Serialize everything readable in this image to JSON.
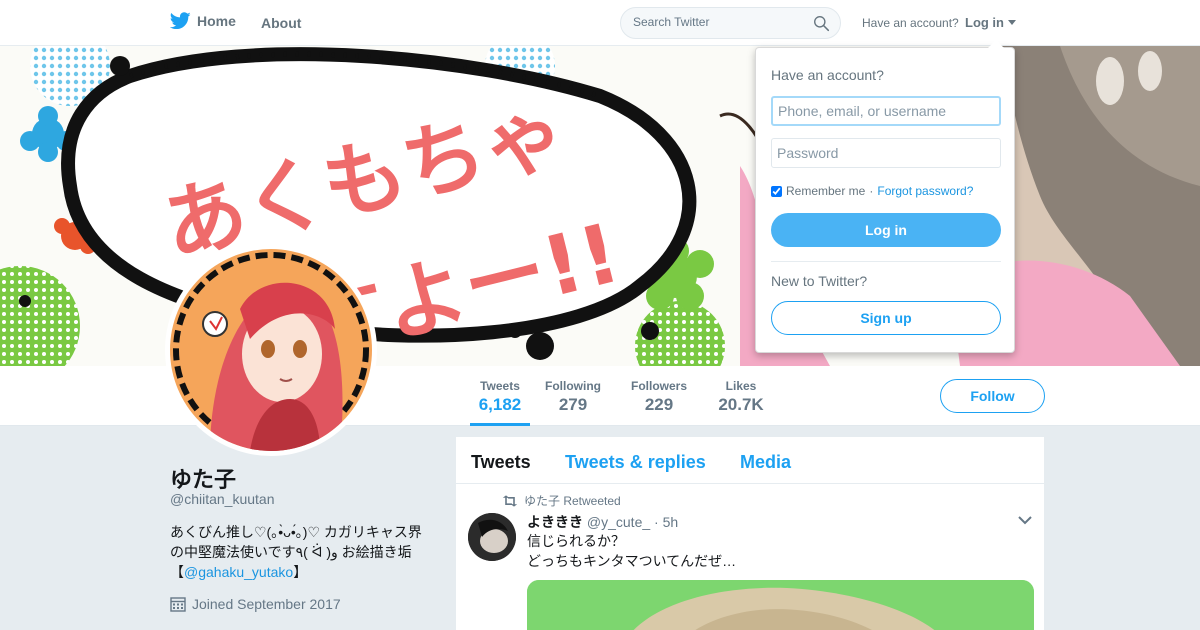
{
  "nav": {
    "home_label": "Home",
    "about_label": "About",
    "search_placeholder": "Search Twitter",
    "have_account": "Have an account?",
    "login_label": "Log in"
  },
  "login_dropdown": {
    "title": "Have an account?",
    "username_placeholder": "Phone, email, or username",
    "password_placeholder": "Password",
    "remember_label": "Remember me",
    "separator": "·",
    "forgot_label": "Forgot password?",
    "login_button": "Log in",
    "new_label": "New to Twitter?",
    "signup_button": "Sign up"
  },
  "banner": {
    "artwork_text_line1": "あくもちゃ",
    "artwork_text_line2": "すよー!!"
  },
  "stats": [
    {
      "label": "Tweets",
      "value": "6,182"
    },
    {
      "label": "Following",
      "value": "279"
    },
    {
      "label": "Followers",
      "value": "229"
    },
    {
      "label": "Likes",
      "value": "20.7K"
    }
  ],
  "follow_label": "Follow",
  "profile": {
    "display_name": "ゆた子",
    "handle": "@chiitan_kuutan",
    "bio_line1": "あくびん推し♡(｡•̀ᴗ•́｡)♡ カガリキャス界",
    "bio_line2": "の中堅魔法使いです٩( ᐛ )و お絵描き垢",
    "bio_bracket_open": "【",
    "bio_mention": "@gahaku_yutako",
    "bio_bracket_close": "】",
    "joined": "Joined September 2017"
  },
  "timeline": {
    "tabs": [
      "Tweets",
      "Tweets & replies",
      "Media"
    ],
    "retweet_context": "ゆた子 Retweeted",
    "tweet": {
      "name": "よききき",
      "handle": "@y_cute_",
      "time": "· 5h",
      "line1": "信じられるか？",
      "line2": "どっちもキンタマついてんだぜ…"
    }
  },
  "colors": {
    "accent": "#1da1f2",
    "login_button": "#4ab3f4",
    "background": "#e6ecf0"
  }
}
